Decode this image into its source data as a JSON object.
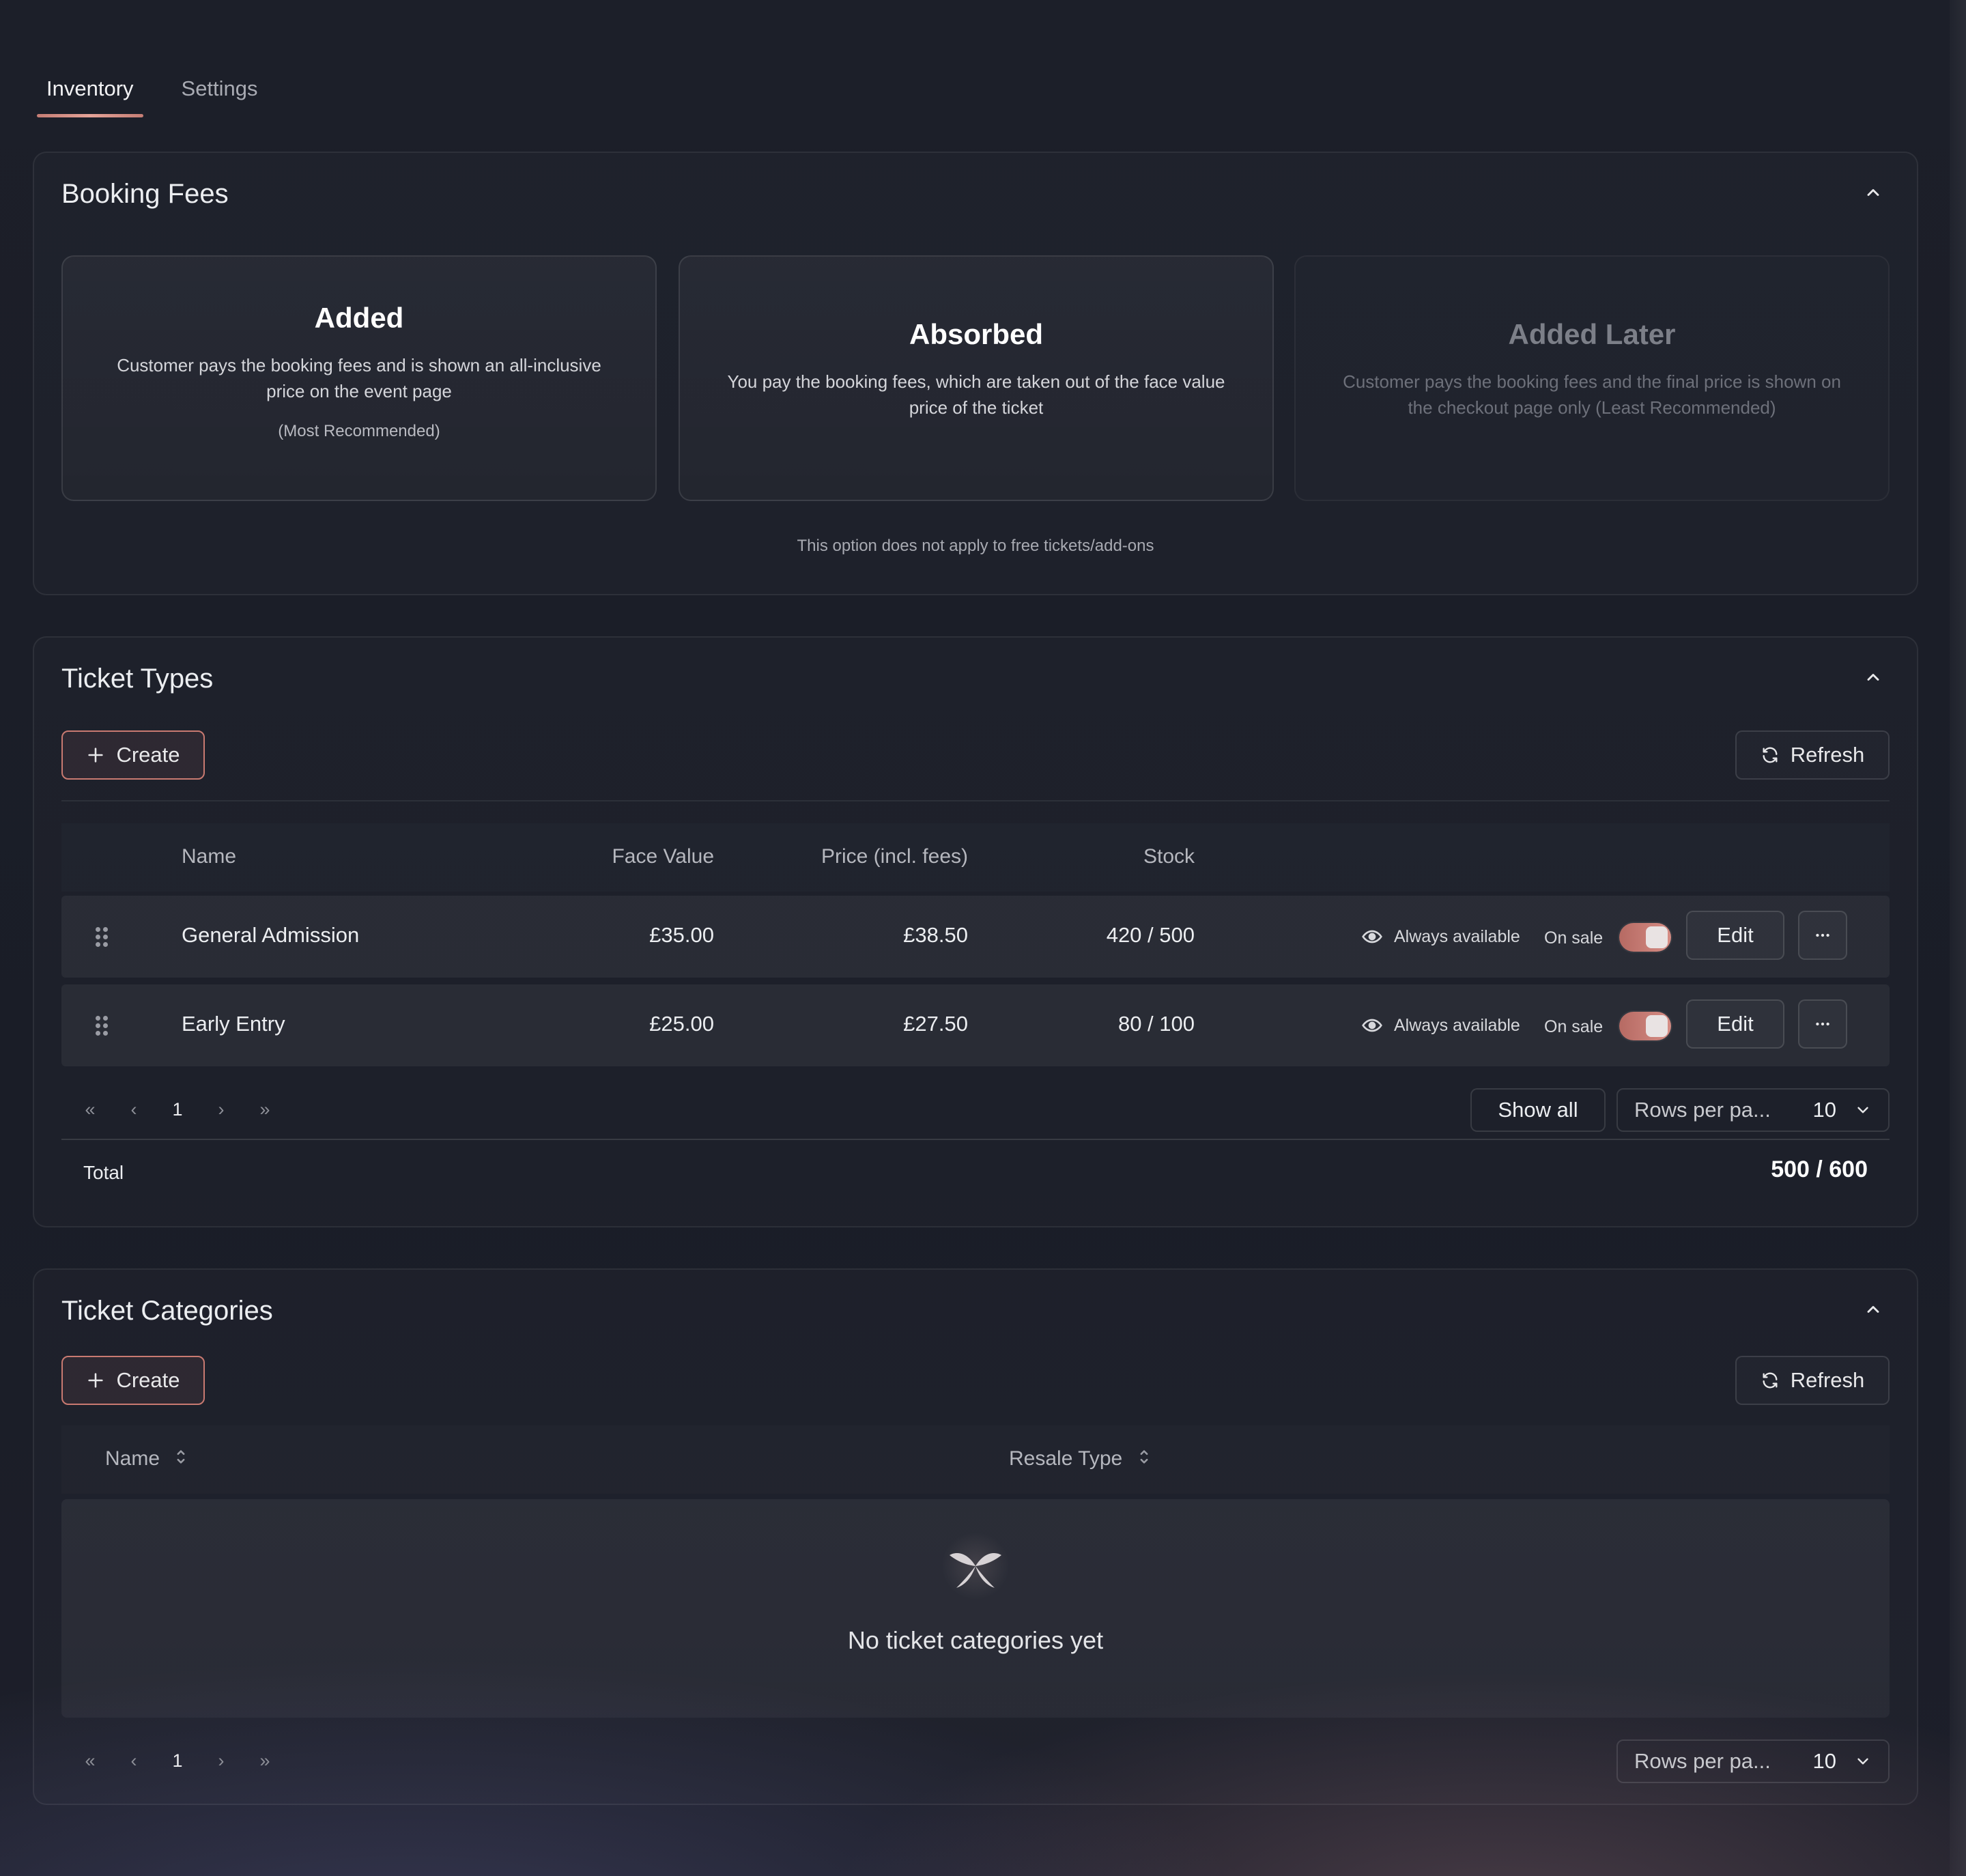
{
  "tabs": [
    {
      "label": "Inventory",
      "active": true
    },
    {
      "label": "Settings",
      "active": false
    }
  ],
  "booking_fees": {
    "title": "Booking Fees",
    "options": [
      {
        "title": "Added",
        "desc": "Customer pays the booking fees and is shown an all-inclusive price on the event page",
        "note": "(Most Recommended)"
      },
      {
        "title": "Absorbed",
        "desc": "You pay the booking fees, which are taken out of the face value price of the ticket",
        "note": ""
      },
      {
        "title": "Added Later",
        "desc": "Customer pays the booking fees and the final price is shown on the checkout page only (Least Recommended)",
        "note": ""
      }
    ],
    "footnote": "This option does not apply to free tickets/add-ons"
  },
  "ticket_types": {
    "title": "Ticket Types",
    "create_label": "Create",
    "refresh_label": "Refresh",
    "columns": {
      "name": "Name",
      "face_value": "Face Value",
      "price": "Price (incl. fees)",
      "stock": "Stock"
    },
    "rows": [
      {
        "name": "General Admission",
        "face_value": "£35.00",
        "price": "£38.50",
        "stock": "420 / 500",
        "availability": "Always available",
        "sale_status": "On sale",
        "on_sale": true,
        "edit_label": "Edit"
      },
      {
        "name": "Early Entry",
        "face_value": "£25.00",
        "price": "£27.50",
        "stock": "80 / 100",
        "availability": "Always available",
        "sale_status": "On sale",
        "on_sale": true,
        "edit_label": "Edit"
      }
    ],
    "pagination": {
      "page": "1",
      "show_all_label": "Show all",
      "rows_label": "Rows per pa...",
      "rows_value": "10"
    },
    "total_label": "Total",
    "total_value": "500 / 600"
  },
  "ticket_categories": {
    "title": "Ticket Categories",
    "create_label": "Create",
    "refresh_label": "Refresh",
    "columns": {
      "name": "Name",
      "resale_type": "Resale Type"
    },
    "empty_text": "No ticket categories yet",
    "pagination": {
      "page": "1",
      "rows_label": "Rows per pa...",
      "rows_value": "10"
    }
  },
  "colors": {
    "accent": "#c97a71",
    "background": "#1b1e28"
  }
}
